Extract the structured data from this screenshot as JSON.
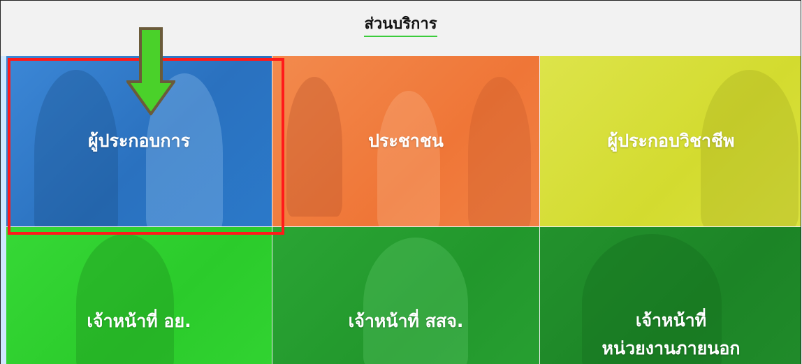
{
  "header": {
    "title": "ส่วนบริการ"
  },
  "tiles": [
    {
      "label": "ผู้ประกอบการ",
      "color": "#2f7fd0"
    },
    {
      "label": "ประชาชน",
      "color": "#f07a3c"
    },
    {
      "label": "ผู้ประกอบวิชาชีพ",
      "color": "#d8df34"
    },
    {
      "label": "เจ้าหน้าที่ อย.",
      "color": "#2ed12e"
    },
    {
      "label": "เจ้าหน้าที่ สสจ.",
      "color": "#239e2e"
    },
    {
      "label_line1": "เจ้าหน้าที่",
      "label_line2": "หน่วยงานภายนอก",
      "color": "#1e8a28"
    }
  ],
  "annotation": {
    "highlight_color": "#ff1a1a",
    "arrow_color": "#4ad12a",
    "arrow_outline_color": "#6b5b3a"
  }
}
